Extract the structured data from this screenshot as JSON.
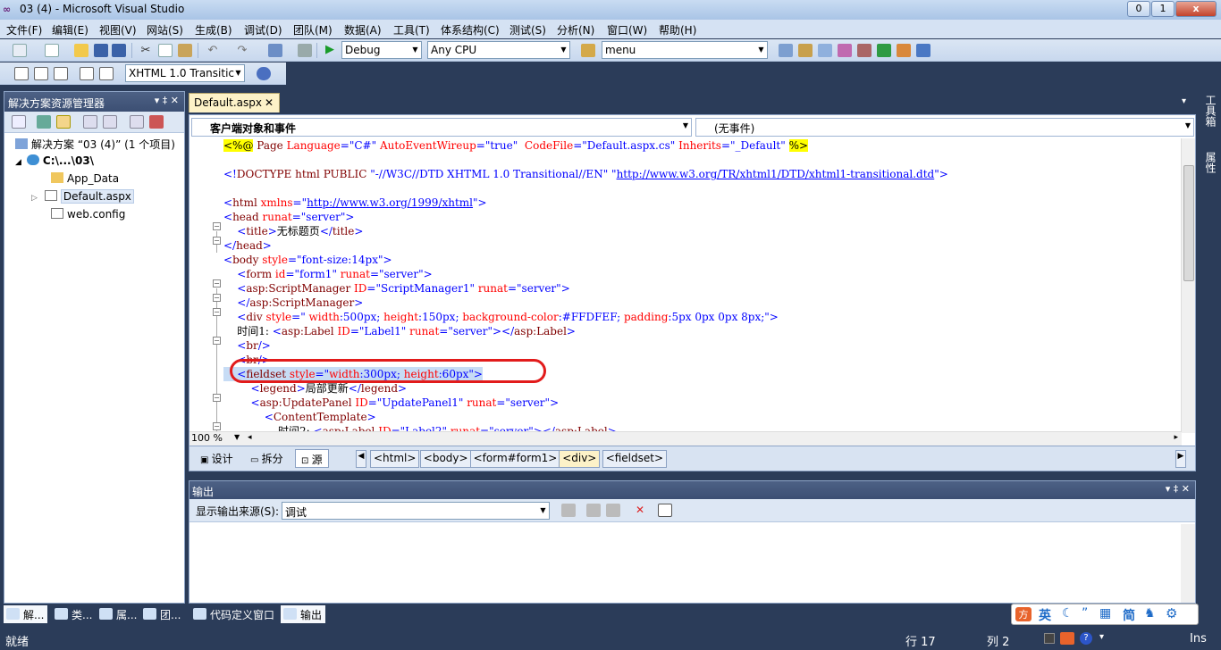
{
  "window": {
    "title": "03 (4) - Microsoft Visual Studio",
    "min": "0",
    "max": "1",
    "close": "x"
  },
  "menu": [
    "文件(F)",
    "编辑(E)",
    "视图(V)",
    "网站(S)",
    "生成(B)",
    "调试(D)",
    "团队(M)",
    "数据(A)",
    "工具(T)",
    "体系结构(C)",
    "测试(S)",
    "分析(N)",
    "窗口(W)",
    "帮助(H)"
  ],
  "toolbar": {
    "config": "Debug",
    "platform": "Any CPU",
    "find": "menu",
    "schema": "XHTML 1.0 Transitic"
  },
  "solution_explorer": {
    "title": "解决方案资源管理器",
    "pin": "▾ ‡ ✕",
    "root": "解决方案 “03 (4)” (1 个项目)",
    "project": "C:\\...\\03\\",
    "items": [
      "App_Data",
      "Default.aspx",
      "web.config"
    ]
  },
  "doc_tab": {
    "label": "Default.aspx",
    "close": "✕"
  },
  "nav": {
    "left": "客户端对象和事件",
    "right": "(无事件)"
  },
  "code": [
    [
      {
        "c": "dir",
        "t": "<%@"
      },
      {
        "c": "tg",
        "t": " Page "
      },
      {
        "c": "at",
        "t": "Language"
      },
      {
        "c": "av",
        "t": "=\"C#\" "
      },
      {
        "c": "at",
        "t": "AutoEventWireup"
      },
      {
        "c": "av",
        "t": "=\"true\"  "
      },
      {
        "c": "at",
        "t": "CodeFile"
      },
      {
        "c": "av",
        "t": "=\"Default.aspx.cs\" "
      },
      {
        "c": "at",
        "t": "Inherits"
      },
      {
        "c": "av",
        "t": "=\"_Default\" "
      },
      {
        "c": "dir",
        "t": "%>"
      }
    ],
    [],
    [
      {
        "c": "av",
        "t": "<!"
      },
      {
        "c": "tg",
        "t": "DOCTYPE html PUBLIC "
      },
      {
        "c": "av",
        "t": "\"-//W3C//DTD XHTML 1.0 Transitional//EN\" \""
      },
      {
        "c": "ln",
        "t": "http://www.w3.org/TR/xhtml1/DTD/xhtml1-transitional.dtd"
      },
      {
        "c": "av",
        "t": "\">"
      }
    ],
    [],
    [
      {
        "c": "av",
        "t": "<"
      },
      {
        "c": "tg",
        "t": "html "
      },
      {
        "c": "at",
        "t": "xmlns"
      },
      {
        "c": "av",
        "t": "=\""
      },
      {
        "c": "ln",
        "t": "http://www.w3.org/1999/xhtml"
      },
      {
        "c": "av",
        "t": "\">"
      }
    ],
    [
      {
        "c": "av",
        "t": "<"
      },
      {
        "c": "tg",
        "t": "head "
      },
      {
        "c": "at",
        "t": "runat"
      },
      {
        "c": "av",
        "t": "=\"server\">"
      }
    ],
    [
      {
        "c": "av",
        "t": "    <"
      },
      {
        "c": "tg",
        "t": "title"
      },
      {
        "c": "av",
        "t": ">"
      },
      {
        "c": "",
        "t": "无标题页"
      },
      {
        "c": "av",
        "t": "</"
      },
      {
        "c": "tg",
        "t": "title"
      },
      {
        "c": "av",
        "t": ">"
      }
    ],
    [
      {
        "c": "av",
        "t": "</"
      },
      {
        "c": "tg",
        "t": "head"
      },
      {
        "c": "av",
        "t": ">"
      }
    ],
    [
      {
        "c": "av",
        "t": "<"
      },
      {
        "c": "tg",
        "t": "body "
      },
      {
        "c": "at",
        "t": "style"
      },
      {
        "c": "av",
        "t": "=\"font-size:14px\">"
      }
    ],
    [
      {
        "c": "av",
        "t": "    <"
      },
      {
        "c": "tg",
        "t": "form "
      },
      {
        "c": "at",
        "t": "id"
      },
      {
        "c": "av",
        "t": "=\"form1\" "
      },
      {
        "c": "at",
        "t": "runat"
      },
      {
        "c": "av",
        "t": "=\"server\">"
      }
    ],
    [
      {
        "c": "av",
        "t": "    <"
      },
      {
        "c": "tg",
        "t": "asp:ScriptManager "
      },
      {
        "c": "at",
        "t": "ID"
      },
      {
        "c": "av",
        "t": "=\"ScriptManager1\" "
      },
      {
        "c": "at",
        "t": "runat"
      },
      {
        "c": "av",
        "t": "=\"server\">"
      }
    ],
    [
      {
        "c": "av",
        "t": "    </"
      },
      {
        "c": "tg",
        "t": "asp:ScriptManager"
      },
      {
        "c": "av",
        "t": ">"
      }
    ],
    [
      {
        "c": "av",
        "t": "    <"
      },
      {
        "c": "tg",
        "t": "div "
      },
      {
        "c": "at",
        "t": "style"
      },
      {
        "c": "av",
        "t": "=\" "
      },
      {
        "c": "at",
        "t": "width"
      },
      {
        "c": "av",
        "t": ":500px; "
      },
      {
        "c": "at",
        "t": "height"
      },
      {
        "c": "av",
        "t": ":150px; "
      },
      {
        "c": "at",
        "t": "background-color"
      },
      {
        "c": "av",
        "t": ":#FFDFEF; "
      },
      {
        "c": "at",
        "t": "padding"
      },
      {
        "c": "av",
        "t": ":5px 0px 0px 8px;\">"
      }
    ],
    [
      {
        "c": "",
        "t": "    时间1: "
      },
      {
        "c": "av",
        "t": "<"
      },
      {
        "c": "tg",
        "t": "asp:Label "
      },
      {
        "c": "at",
        "t": "ID"
      },
      {
        "c": "av",
        "t": "=\"Label1\" "
      },
      {
        "c": "at",
        "t": "runat"
      },
      {
        "c": "av",
        "t": "=\"server\"></"
      },
      {
        "c": "tg",
        "t": "asp:Label"
      },
      {
        "c": "av",
        "t": ">"
      }
    ],
    [
      {
        "c": "av",
        "t": "    <"
      },
      {
        "c": "tg",
        "t": "br"
      },
      {
        "c": "av",
        "t": "/>"
      }
    ],
    [
      {
        "c": "av",
        "t": "    <"
      },
      {
        "c": "tg",
        "t": "br"
      },
      {
        "c": "av",
        "t": "/>"
      }
    ],
    [
      {
        "c": "av",
        "t": "    <"
      },
      {
        "c": "tg",
        "t": "fieldset "
      },
      {
        "c": "at",
        "t": "style"
      },
      {
        "c": "av",
        "t": "=\""
      },
      {
        "c": "at",
        "t": "width"
      },
      {
        "c": "av",
        "t": ":300px; "
      },
      {
        "c": "at",
        "t": "height"
      },
      {
        "c": "av",
        "t": ":60px\">"
      }
    ],
    [
      {
        "c": "av",
        "t": "        <"
      },
      {
        "c": "tg",
        "t": "legend"
      },
      {
        "c": "av",
        "t": ">"
      },
      {
        "c": "",
        "t": "局部更新"
      },
      {
        "c": "av",
        "t": "</"
      },
      {
        "c": "tg",
        "t": "legend"
      },
      {
        "c": "av",
        "t": ">"
      }
    ],
    [
      {
        "c": "av",
        "t": "        <"
      },
      {
        "c": "tg",
        "t": "asp:UpdatePanel "
      },
      {
        "c": "at",
        "t": "ID"
      },
      {
        "c": "av",
        "t": "=\"UpdatePanel1\" "
      },
      {
        "c": "at",
        "t": "runat"
      },
      {
        "c": "av",
        "t": "=\"server\">"
      }
    ],
    [
      {
        "c": "av",
        "t": "            <"
      },
      {
        "c": "tg",
        "t": "ContentTemplate"
      },
      {
        "c": "av",
        "t": ">"
      }
    ],
    [
      {
        "c": "",
        "t": "                时间2: "
      },
      {
        "c": "av",
        "t": "<"
      },
      {
        "c": "tg",
        "t": "asp:Label "
      },
      {
        "c": "at",
        "t": "ID"
      },
      {
        "c": "av",
        "t": "=\"Label2\" "
      },
      {
        "c": "at",
        "t": "runat"
      },
      {
        "c": "av",
        "t": "=\"server\"></"
      },
      {
        "c": "tg",
        "t": "asp:Label"
      },
      {
        "c": "av",
        "t": ">"
      }
    ]
  ],
  "editor": {
    "zoom": "100 %"
  },
  "views": {
    "design": "设计",
    "split": "拆分",
    "source": "源"
  },
  "breadcrumbs": [
    "<html>",
    "<body>",
    "<form#form1>",
    "<div>",
    "<fieldset>"
  ],
  "output": {
    "title": "输出",
    "source_label": "显示输出来源(S):",
    "source_value": "调试"
  },
  "bottom_tabs": [
    "解...",
    "类...",
    "属...",
    "团...",
    "代码定义窗口",
    "输出"
  ],
  "right_strip": [
    "工具箱",
    "属性"
  ],
  "ime": {
    "label": "英"
  },
  "status": {
    "ready": "就绪",
    "row": "行 17",
    "col": "列 2",
    "ins": "Ins"
  }
}
